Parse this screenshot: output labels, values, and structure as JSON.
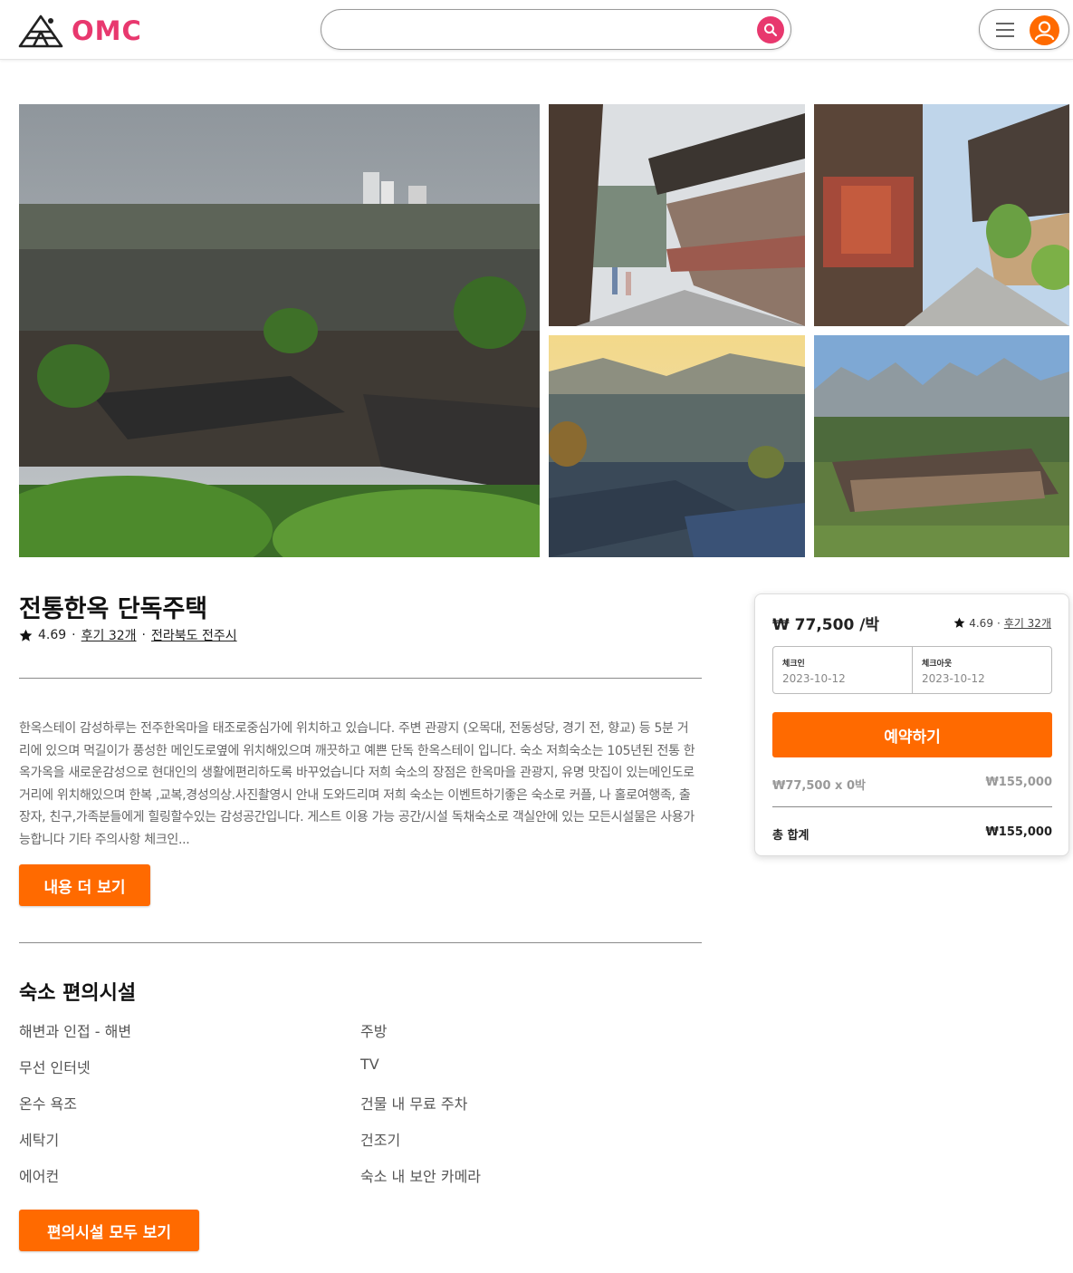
{
  "header": {
    "logo_text": "OMC",
    "search_placeholder": "",
    "search_value": ""
  },
  "listing": {
    "title": "전통한옥 단독주택",
    "rating": "4.69",
    "reviews_label": "후기 32개",
    "location": "전라북도 전주시",
    "description": "한옥스테이 감성하루는 전주한옥마을 태조로중심가에 위치하고 있습니다. 주변 관광지 (오목대, 전동성당, 경기 전, 향교) 등 5분 거리에 있으며 먹길이가 풍성한 메인도로옆에 위치해있으며 깨끗하고 예쁜 단독 한옥스테이 입니다. 숙소 저희숙소는 105년된 전통 한옥가옥을 새로운감성으로 현대인의 생활에편리하도록 바꾸었습니다 저희 숙소의 장점은 한옥마을 관광지, 유명 맛집이 있는메인도로 거리에 위치해있으며 한복 ,교복,경성의상.사진촬영시 안내 도와드리며 저희 숙소는 이벤트하기좋은 숙소로 커플, 나 홀로여행족, 출장자, 친구,가족분들에게 힐링할수있는 감성공간입니다. 게스트 이용 가능 공간/시설 독채숙소로 객실안에 있는 모든시설물은 사용가능합니다 기타 주의사항 체크인...",
    "more_button": "내용 더 보기"
  },
  "amenities": {
    "title": "숙소 편의시설",
    "left": [
      "해변과 인접 - 해변",
      "무선 인터넷",
      "온수 욕조",
      "세탁기",
      "에어컨"
    ],
    "right": [
      "주방",
      "TV",
      "건물 내 무료 주차",
      "건조기",
      "숙소 내 보안 카메라"
    ],
    "all_button": "편의시설 모두 보기"
  },
  "booking": {
    "price": "₩ 77,500 /박",
    "rating": "4.69",
    "reviews_label": "후기 32개",
    "checkin_label": "체크인",
    "checkin_value": "2023-10-12",
    "checkout_label": "체크아웃",
    "checkout_value": "2023-10-12",
    "reserve_button": "예약하기",
    "calc_label": "₩77,500 x 0박",
    "calc_value": "₩155,000",
    "total_label": "총 합계",
    "total_value": "₩155,000"
  },
  "colors": {
    "brand_pink": "#e8386e",
    "accent_orange": "#ff6a00"
  }
}
